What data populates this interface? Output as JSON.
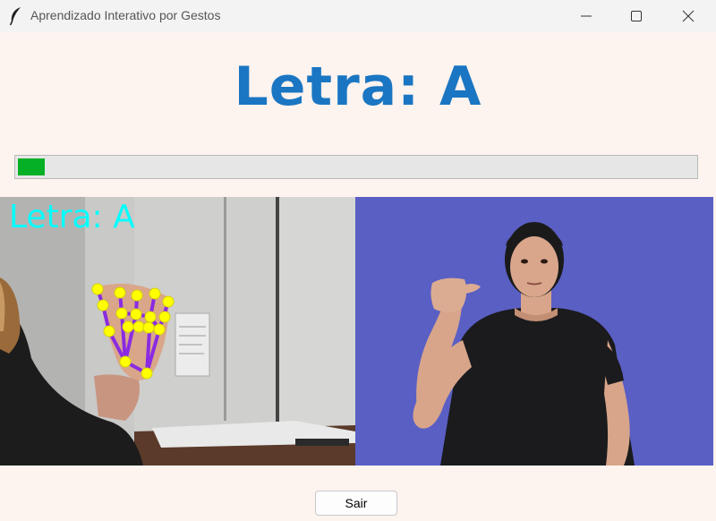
{
  "window": {
    "title": "Aprendizado Interativo por Gestos",
    "icons": [
      "feather-icon",
      "minimize-icon",
      "maximize-icon",
      "close-icon"
    ]
  },
  "header": {
    "letter_text": "Letra: A",
    "color": "#1a76c2"
  },
  "progress": {
    "fraction": 0.04,
    "fill_color": "#06b025"
  },
  "camera_view": {
    "overlay_text": "Letra: A",
    "overlay_color": "#00ffff",
    "landmark_color": "#ffff00",
    "connection_color": "#8a2be2"
  },
  "reference_view": {
    "background_color": "#5a5fc4"
  },
  "footer": {
    "exit_label": "Sair"
  }
}
